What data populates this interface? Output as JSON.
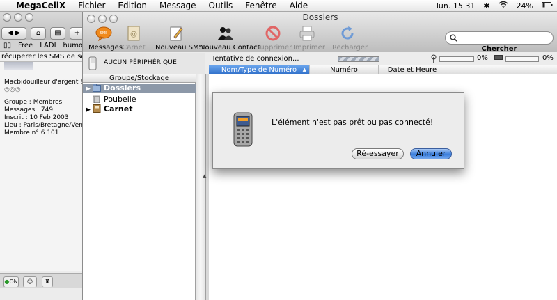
{
  "menubar": {
    "app": "MegaCellX",
    "items": [
      "Fichier",
      "Edition",
      "Message",
      "Outils",
      "Fenêtre",
      "Aide"
    ],
    "clock": "lun. 15 31",
    "battery": "24%"
  },
  "background_window": {
    "bookmarks": [
      "Free",
      "LADI",
      "humo"
    ],
    "subtitle": "récuperer les SMS de son té",
    "profile": {
      "tagline": "Macbidouilleur d'argent !",
      "group": "Groupe : Membres",
      "messages": "Messages : 749",
      "joined": "Inscrit : 10 Feb 2003",
      "location": "Lieu : Paris/Bretagne/Venezia",
      "member": "Membre n° 6 101"
    },
    "status_on": "ON"
  },
  "window": {
    "title": "Dossiers",
    "toolbar": {
      "messages": "Messages",
      "carnet": "Carnet",
      "new_sms": "Nouveau SMS",
      "new_contact": "Nouveau Contact",
      "delete": "Supprimer",
      "print": "Imprimer",
      "reload": "Recharger",
      "search_label": "Chercher",
      "search_value": ""
    },
    "device": "AUCUN PÉRIPHÉRIQUE",
    "tree": {
      "header": "Groupe/Stockage",
      "items": [
        {
          "label": "Dossiers",
          "selected": true
        },
        {
          "label": "Poubelle",
          "selected": false
        },
        {
          "label": "Carnet",
          "selected": false
        }
      ]
    },
    "status": {
      "connection": "Tentative de connexion...",
      "signal_pct": "0%",
      "battery_pct": "0%"
    },
    "columns": [
      "Nom/Type de Numéro",
      "Numéro",
      "Date et Heure"
    ]
  },
  "dialog": {
    "message": "L'élément n'est pas prêt ou pas connecté!",
    "retry": "Ré-essayer",
    "cancel": "Annuler"
  },
  "colors": {
    "selection": "#8c98a8",
    "active_column": "#2f6fc9",
    "default_button": "#3a7edc"
  }
}
